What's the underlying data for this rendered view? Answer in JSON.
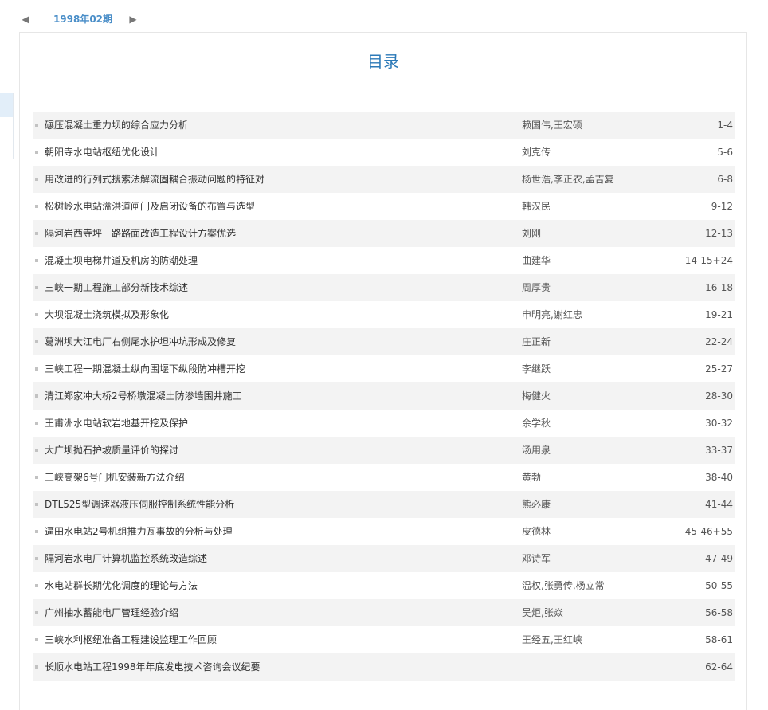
{
  "issue_nav": {
    "prev_icon": "◀",
    "next_icon": "▶",
    "label": "1998年02期"
  },
  "toc": {
    "title": "目录",
    "items": [
      {
        "title": "碾压混凝土重力坝的综合应力分析",
        "authors": "赖国伟,王宏硕",
        "pages": "1-4"
      },
      {
        "title": "朝阳寺水电站枢纽优化设计",
        "authors": "刘克传",
        "pages": "5-6"
      },
      {
        "title": "用改进的行列式搜索法解流固耦合振动问题的特征对",
        "authors": "杨世浩,李正农,孟吉复",
        "pages": "6-8"
      },
      {
        "title": "松树岭水电站溢洪道闸门及启闭设备的布置与选型",
        "authors": "韩汉民",
        "pages": "9-12"
      },
      {
        "title": "隔河岩西寺坪一路路面改造工程设计方案优选",
        "authors": "刘刚",
        "pages": "12-13"
      },
      {
        "title": "混凝土坝电梯井道及机房的防潮处理",
        "authors": "曲建华",
        "pages": "14-15+24"
      },
      {
        "title": "三峡一期工程施工部分新技术综述",
        "authors": "周厚贵",
        "pages": "16-18"
      },
      {
        "title": "大坝混凝土浇筑模拟及形象化",
        "authors": "申明亮,谢红忠",
        "pages": "19-21"
      },
      {
        "title": "葛洲坝大江电厂右侧尾水护坦冲坑形成及修复",
        "authors": "庄正新",
        "pages": "22-24"
      },
      {
        "title": "三峡工程一期混凝土纵向围堰下纵段防冲槽开挖",
        "authors": "李继跃",
        "pages": "25-27"
      },
      {
        "title": "清江郑家冲大桥2号桥墩混凝土防渗墙围井施工",
        "authors": "梅健火",
        "pages": "28-30"
      },
      {
        "title": "王甫洲水电站软岩地基开挖及保护",
        "authors": "余学秋",
        "pages": "30-32"
      },
      {
        "title": "大广坝抛石护坡质量评价的探讨",
        "authors": "汤用泉",
        "pages": "33-37"
      },
      {
        "title": "三峡高架6号门机安装新方法介绍",
        "authors": "黄勃",
        "pages": "38-40"
      },
      {
        "title": "DTL525型调速器液压伺服控制系统性能分析",
        "authors": "熊必康",
        "pages": "41-44"
      },
      {
        "title": "逼田水电站2号机组推力瓦事故的分析与处理",
        "authors": "皮德林",
        "pages": "45-46+55"
      },
      {
        "title": "隔河岩水电厂计算机监控系统改造综述",
        "authors": "邓诗军",
        "pages": "47-49"
      },
      {
        "title": "水电站群长期优化调度的理论与方法",
        "authors": "温权,张勇传,杨立常",
        "pages": "50-55"
      },
      {
        "title": "广州抽水蓄能电厂管理经验介绍",
        "authors": "吴炬,张焱",
        "pages": "56-58"
      },
      {
        "title": "三峡水利枢纽准备工程建设监理工作回顾",
        "authors": "王经五,王红峡",
        "pages": "58-61"
      },
      {
        "title": "长顺水电站工程1998年年底发电技术咨询会议纪要",
        "authors": "",
        "pages": "62-64"
      }
    ]
  }
}
